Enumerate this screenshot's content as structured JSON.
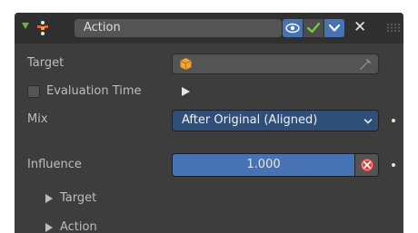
{
  "header": {
    "name_value": "Action",
    "icons": {
      "collapse": "collapse-arrow-icon",
      "constraint": "action-constraint-icon",
      "eye": "eye-icon",
      "check": "checkmark-icon",
      "chevron": "chevron-down-icon",
      "close": "close-icon",
      "grip": "drag-grip-icon"
    },
    "close_glyph": "✕"
  },
  "fields": {
    "target_label": "Target",
    "target_icon": "object-cube-icon",
    "eyedropper_icon": "eyedropper-icon",
    "evaluation_time_label": "Evaluation Time",
    "evaluation_time_checked": false,
    "mix_label": "Mix",
    "mix_value": "After Original (Aligned)",
    "influence_label": "Influence",
    "influence_value": "1.000",
    "influence_fraction": 1.0
  },
  "subpanels": [
    {
      "label": "Target"
    },
    {
      "label": "Action"
    }
  ],
  "colors": {
    "panel_bg": "#3d3d3d",
    "header_bg": "#303030",
    "accent_blue": "#4772b3",
    "dropdown_blue": "#2f4f78",
    "check_green": "#72cf3b",
    "collapse_green": "#68b248",
    "driver_red": "#e63b3b",
    "cube_orange": "#f0a431"
  }
}
